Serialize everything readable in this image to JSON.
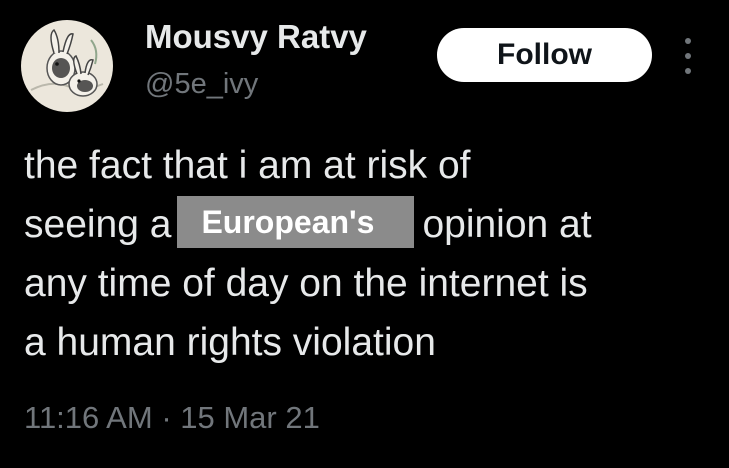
{
  "author": {
    "display_name": "Mousvy Ratvy",
    "handle": "@5e_ivy",
    "avatar_icon": "rabbit-illustration-avatar"
  },
  "actions": {
    "follow_label": "Follow",
    "more_icon": "vertical-ellipsis-icon"
  },
  "tweet": {
    "line1": "the fact that i am at risk of",
    "line2_before": "seeing a",
    "line2_redacted": "European's",
    "line2_after": "opinion at",
    "line3": "any time of day on the internet is",
    "line4": "a human rights violation"
  },
  "meta": {
    "time": "11:16 AM",
    "separator": "·",
    "date": "15 Mar 21"
  },
  "colors": {
    "background": "#000000",
    "text_primary": "#e7e9ea",
    "text_secondary": "#71767b",
    "follow_bg": "#ffffff",
    "redaction_bg": "#8b8b8b"
  }
}
